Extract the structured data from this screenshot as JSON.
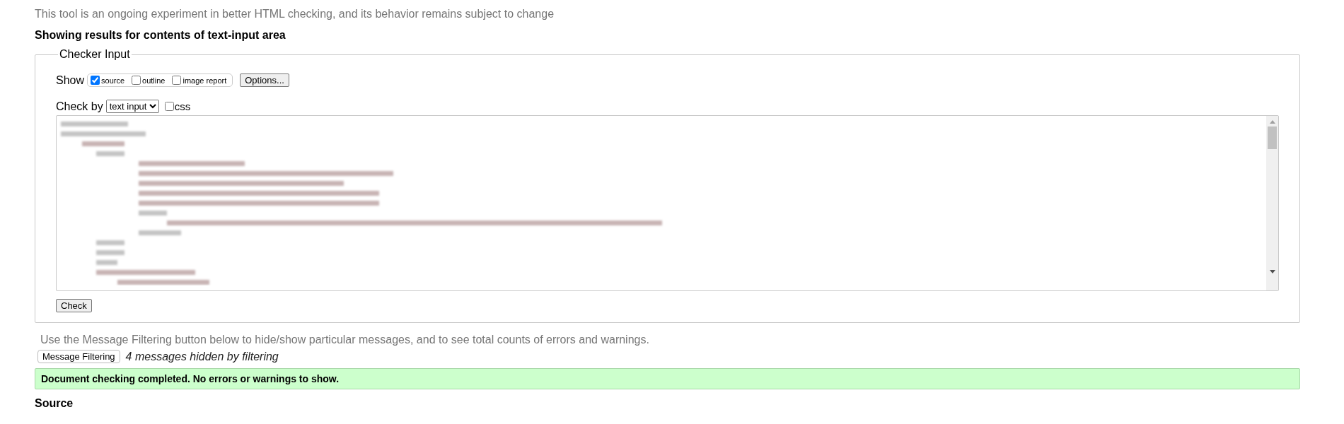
{
  "intro": "This tool is an ongoing experiment in better HTML checking, and its behavior remains subject to change",
  "results_heading": "Showing results for contents of text-input area",
  "checker_input": {
    "legend": "Checker Input",
    "show_label": "Show",
    "show_options": [
      {
        "label": "source",
        "checked": true
      },
      {
        "label": "outline",
        "checked": false
      },
      {
        "label": "image report",
        "checked": false
      }
    ],
    "options_button": "Options...",
    "check_by_label": "Check by",
    "check_by_value": "text input",
    "css": {
      "label": "css",
      "checked": false
    },
    "check_button": "Check"
  },
  "filter_note": "Use the Message Filtering button below to hide/show particular messages, and to see total counts of errors and warnings.",
  "filter_button": "Message Filtering",
  "hidden_count": "4 messages hidden by filtering",
  "status": "Document checking completed. No errors or warnings to show.",
  "source_heading": "Source"
}
